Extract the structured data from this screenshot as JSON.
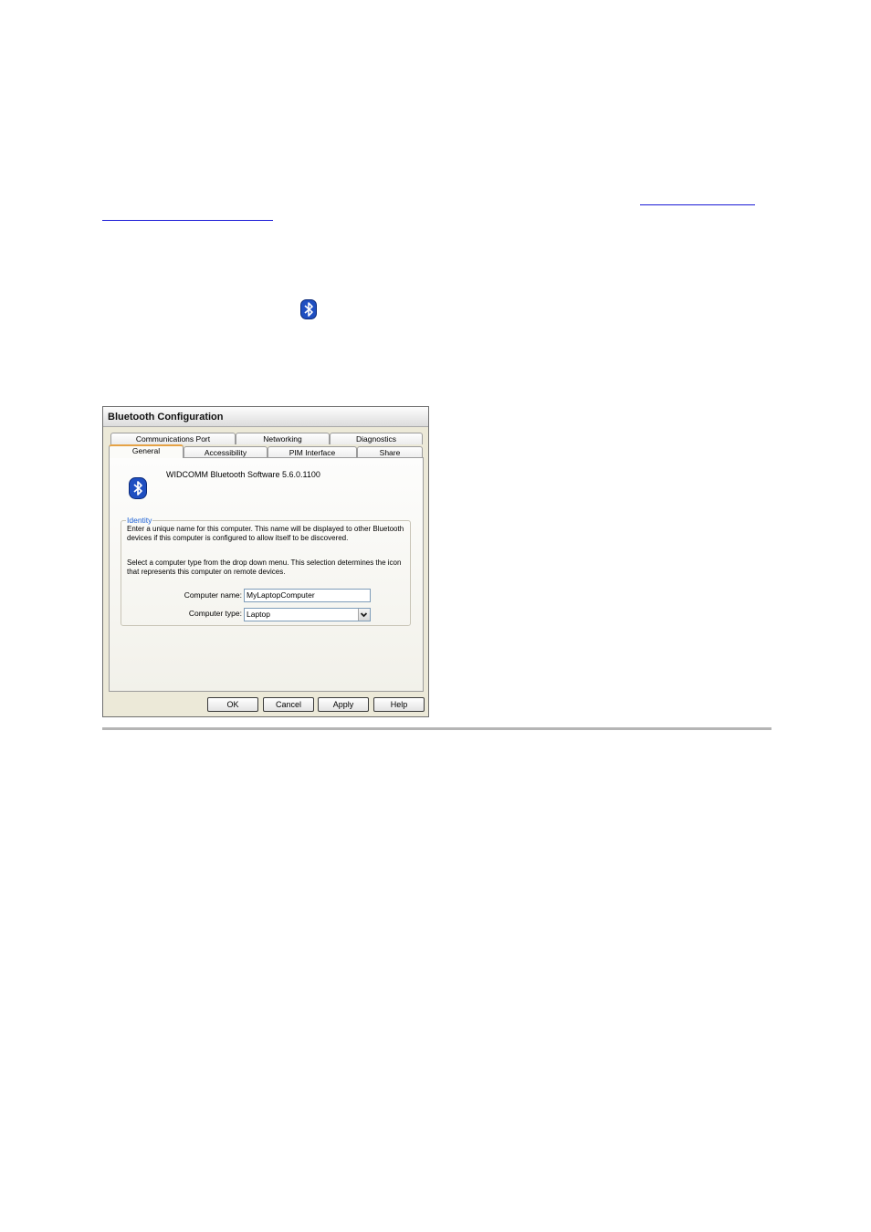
{
  "dialog": {
    "title": "Bluetooth Configuration",
    "tabs_back": [
      "Communications Port",
      "Networking",
      "Diagnostics"
    ],
    "tabs_front": [
      "General",
      "Accessibility",
      "PIM Interface",
      "Share"
    ],
    "active_tab": "General",
    "version": "WIDCOMM Bluetooth Software 5.6.0.1100",
    "identity": {
      "label": "Identity",
      "para1_line1": "Enter a unique name for this computer.  This name will be displayed to other Bluetooth",
      "para1_line2": "devices if this computer is configured to allow itself to be discovered.",
      "para2_line1": "Select a computer type from the drop down menu.  This selection determines the icon",
      "para2_line2": "that represents this computer on remote devices.",
      "name_label": "Computer name:",
      "name_value": "MyLaptopComputer",
      "type_label": "Computer type:",
      "type_value": "Laptop"
    },
    "buttons": {
      "ok": "OK",
      "cancel": "Cancel",
      "apply": "Apply",
      "help": "Help"
    }
  },
  "colors": {
    "link": "#1a1ad6",
    "bluetooth_blue": "#1f4fc1",
    "tab_accent": "#e5a245",
    "group_label": "#1b5fd6"
  },
  "icons": [
    "bluetooth-icon",
    "chevron-down-icon"
  ]
}
